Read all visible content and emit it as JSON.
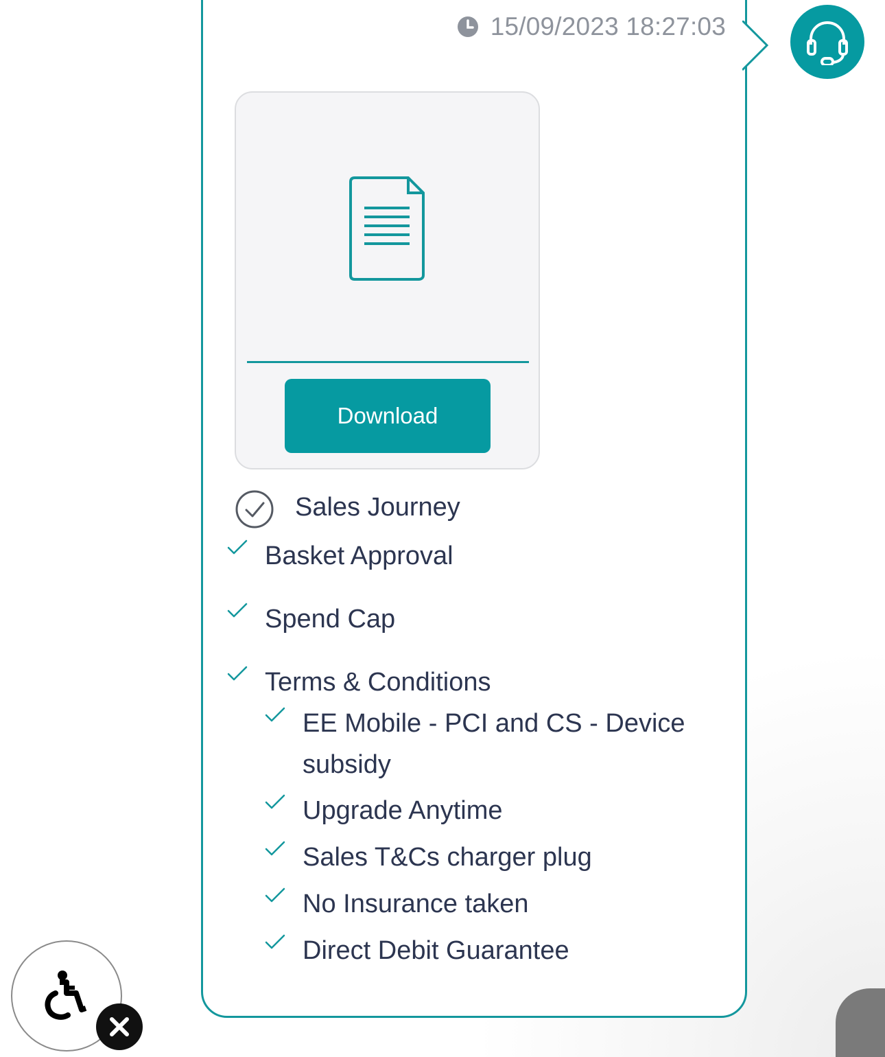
{
  "message": {
    "timestamp": "15/09/2023 18:27:03",
    "sender_icon": "headset-icon"
  },
  "attachment": {
    "icon": "document-icon",
    "download_label": "Download"
  },
  "journey": {
    "title": "Sales Journey",
    "items": [
      {
        "label": "Basket Approval"
      },
      {
        "label": "Spend Cap"
      },
      {
        "label": "Terms & Conditions",
        "children": [
          {
            "label": "EE Mobile - PCI and CS - Device subsidy"
          },
          {
            "label": "Upgrade Anytime"
          },
          {
            "label": "Sales T&Cs charger plug"
          },
          {
            "label": "No Insurance taken"
          },
          {
            "label": "Direct Debit Guarantee"
          }
        ]
      }
    ]
  },
  "widgets": {
    "accessibility_icon": "wheelchair-icon",
    "close_icon": "close-icon"
  },
  "colors": {
    "accent": "#069aa1",
    "border": "#13979d",
    "text": "#2c3550",
    "muted": "#8e939c"
  }
}
